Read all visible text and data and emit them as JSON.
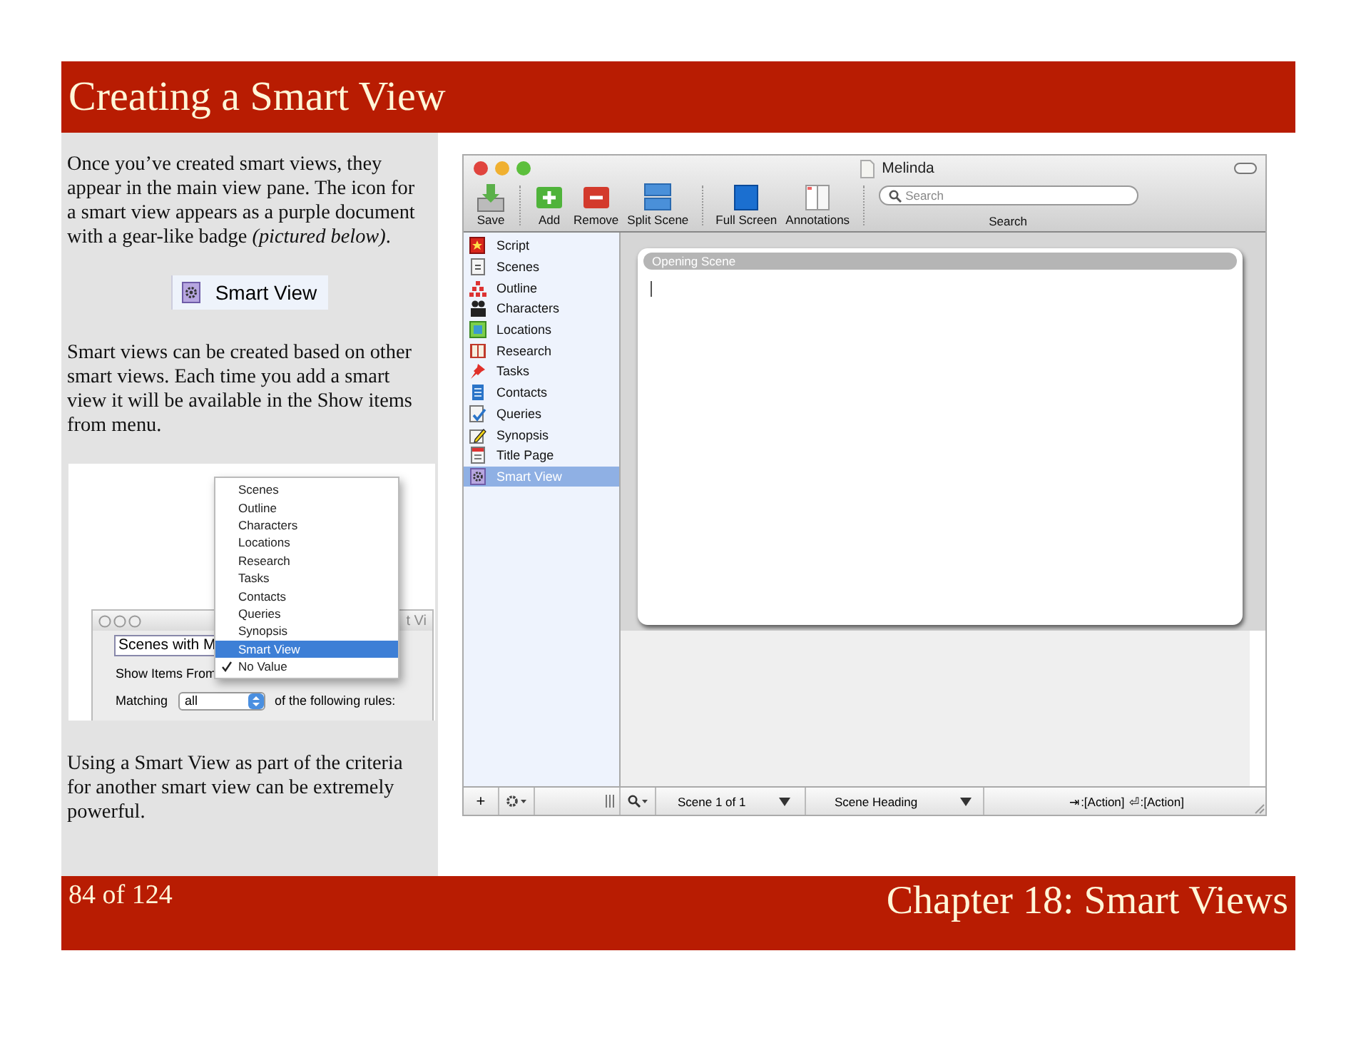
{
  "header": {
    "title": "Creating a Smart View"
  },
  "notes": {
    "paragraphs": [
      "Once you’ve created smart views, they appear in the main view pane. The icon for a smart view appears as a purple document with a gear-like badge *(pictured below)*.",
      "Smart views can be created based on other smart views. Each time you add a smart view it will be available in the Show items from menu.",
      "Using a Smart View as part of the criteria for another smart view can be extremely powerful."
    ],
    "example": {
      "label": "Smart View"
    }
  },
  "inset": {
    "window": {
      "title": "t Vi",
      "name_value": "Scenes with M",
      "show_label": "Show Items From",
      "matching_label": "Matching",
      "matching_value": "all",
      "rules_label": "of the following rules:"
    },
    "menu": [
      {
        "label": "Scenes",
        "selected": false,
        "checked": false
      },
      {
        "label": "Outline",
        "selected": false,
        "checked": false
      },
      {
        "label": "Characters",
        "selected": false,
        "checked": false
      },
      {
        "label": "Locations",
        "selected": false,
        "checked": false
      },
      {
        "label": "Research",
        "selected": false,
        "checked": false
      },
      {
        "label": "Tasks",
        "selected": false,
        "checked": false
      },
      {
        "label": "Contacts",
        "selected": false,
        "checked": false
      },
      {
        "label": "Queries",
        "selected": false,
        "checked": false
      },
      {
        "label": "Synopsis",
        "selected": false,
        "checked": false
      },
      {
        "label": "Smart View",
        "selected": true,
        "checked": false
      },
      {
        "label": "No Value",
        "selected": false,
        "checked": true
      }
    ]
  },
  "app": {
    "window": {
      "title": "Melinda"
    },
    "toolbar": [
      {
        "kind": "save",
        "label": "Save"
      },
      {
        "kind": "separator"
      },
      {
        "kind": "add",
        "label": "Add"
      },
      {
        "kind": "remove",
        "label": "Remove"
      },
      {
        "kind": "split",
        "label": "Split Scene"
      },
      {
        "kind": "separator"
      },
      {
        "kind": "fullscreen",
        "label": "Full Screen"
      },
      {
        "kind": "annotations",
        "label": "Annotations"
      },
      {
        "kind": "separator"
      }
    ],
    "search": {
      "placeholder": "Search",
      "label": "Search"
    },
    "binder": [
      {
        "kind": "script",
        "label": "Script",
        "selected": false
      },
      {
        "kind": "scenes",
        "label": "Scenes",
        "selected": false
      },
      {
        "kind": "outline",
        "label": "Outline",
        "selected": false
      },
      {
        "kind": "characters",
        "label": "Characters",
        "selected": false
      },
      {
        "kind": "locations",
        "label": "Locations",
        "selected": false
      },
      {
        "kind": "research",
        "label": "Research",
        "selected": false
      },
      {
        "kind": "tasks",
        "label": "Tasks",
        "selected": false
      },
      {
        "kind": "contacts",
        "label": "Contacts",
        "selected": false
      },
      {
        "kind": "queries",
        "label": "Queries",
        "selected": false
      },
      {
        "kind": "synopsis",
        "label": "Synopsis",
        "selected": false
      },
      {
        "kind": "titlepage",
        "label": "Title Page",
        "selected": false
      },
      {
        "kind": "smartview",
        "label": "Smart View",
        "selected": true
      }
    ],
    "scene_card": {
      "title": "Opening Scene"
    },
    "status_bar": {
      "add": "+",
      "scene": "Scene 1 of 1",
      "element": "Scene Heading",
      "tab_hint": "⇥:[Action]",
      "return_hint": "⏎:[Action]"
    }
  },
  "footer": {
    "page": "84 of 124",
    "chapter": "Chapter 18: Smart Views"
  }
}
